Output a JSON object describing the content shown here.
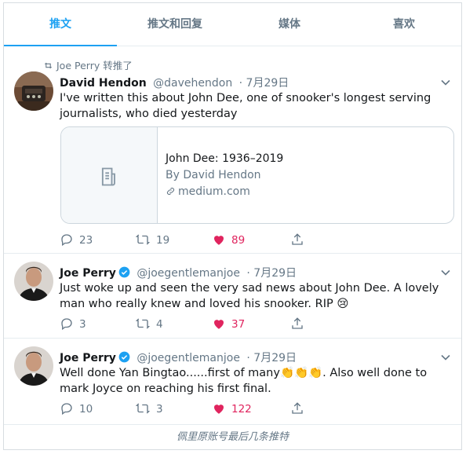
{
  "tabs": [
    "推文",
    "推文和回复",
    "媒体",
    "喜欢"
  ],
  "tweets": [
    {
      "retweet_context": "Joe Perry 转推了",
      "name": "David Hendon",
      "handle": "@davehendon",
      "date": "· 7月29日",
      "text": "I've written this about John Dee, one of snooker's longest serving journalists, who died yesterday",
      "card": {
        "title": "John Dee: 1936–2019",
        "author": "By David Hendon",
        "domain": "medium.com"
      },
      "replies": "23",
      "retweets": "19",
      "likes": "89"
    },
    {
      "name": "Joe Perry",
      "handle": "@joegentlemanjoe",
      "date": "· 7月29日",
      "text": "Just woke up and seen the very sad news about John Dee. A lovely man who really knew and loved his snooker. RIP 😢",
      "replies": "3",
      "retweets": "4",
      "likes": "37"
    },
    {
      "name": "Joe Perry",
      "handle": "@joegentlemanjoe",
      "date": "· 7月29日",
      "text": "Well done Yan Bingtao......first of many👏👏👏. Also well done to mark Joyce on reaching his first final.",
      "replies": "10",
      "retweets": "3",
      "likes": "122"
    }
  ],
  "footer_caption": "佩里原账号最后几条推特",
  "colors": {
    "accent": "#1da1f2",
    "like": "#e0245e",
    "muted": "#657786"
  }
}
